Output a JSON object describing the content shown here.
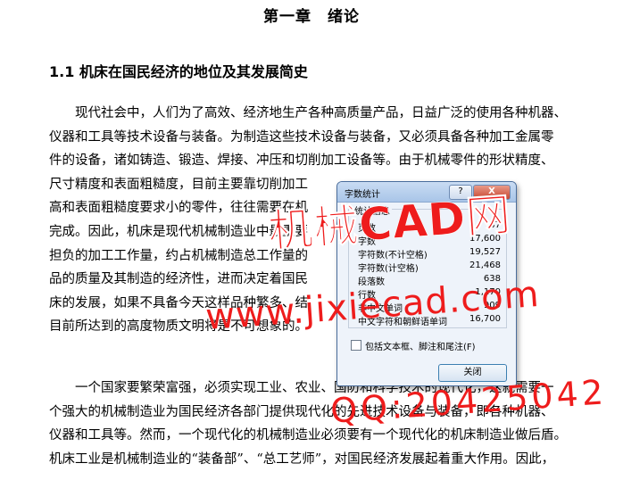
{
  "document": {
    "chapter_title": "第一章　绪论",
    "section_title": "1.1 机床在国民经济的地位及其发展简史",
    "paragraph1_lines": [
      "现代社会中，人们为了高效、经济地生产各种高质量产品，日益广泛的使用各种机器、",
      "仪器和工具等技术设备与装备。为制造这些技术设备与装备，又必须具备各种加工金属零",
      "件的设备，诸如铸造、锻造、焊接、冲压和切削加工设备等。由于机械零件的形状精度、",
      "尺寸精度和表面粗糙度，目前主要靠切削加工",
      "高和表面粗糙度要求小的零件，往往需要在机",
      "完成。因此，机床是现代机械制造业中最重要",
      "担负的加工工作量，约占机械制造总工作量的",
      "品的质量及其制造的经济性，进而决定着国民",
      "床的发展，如果不具备今天这样品种繁多、结",
      "目前所达到的高度物质文明将是不可想象的。"
    ],
    "paragraph2_lines": [
      "一个国家要繁荣富强，必须实现工业、农业、国防和科学技术的现代化，这就需要一",
      "个强大的机械制造业为国民经济各部门提供现代化的先进技术设备与装备，即各种机器、",
      "仪器和工具等。然而，一个现代化的机械制造业必须要有一个现代化的机床制造业做后盾。",
      "机床工业是机械制造业的“装备部”、“总工艺师”，对国民经济发展起着重大作用。因此，"
    ]
  },
  "dialog": {
    "title": "字数统计",
    "help_label": "?",
    "close_icon_label": "X",
    "group_title": "统计信息",
    "stats": [
      {
        "label": "页数",
        "value": "37"
      },
      {
        "label": "字数",
        "value": "17,600"
      },
      {
        "label": "字符数(不计空格)",
        "value": "19,527"
      },
      {
        "label": "字符数(计空格)",
        "value": "21,468"
      },
      {
        "label": "段落数",
        "value": "638"
      },
      {
        "label": "行数",
        "value": "1,170"
      },
      {
        "label": "非中文单词",
        "value": "909"
      },
      {
        "label": "中文字符和朝鲜语单词",
        "value": "16,700"
      }
    ],
    "checkbox_label": "包括文本框、脚注和尾注(F)",
    "checkbox_checked": false,
    "close_button_label": "关闭"
  },
  "watermark": {
    "line1": "机械CAD网",
    "line2": "www.jixiecad.com",
    "line3": "QQ:20425042",
    "color": "#ee1c1c"
  }
}
